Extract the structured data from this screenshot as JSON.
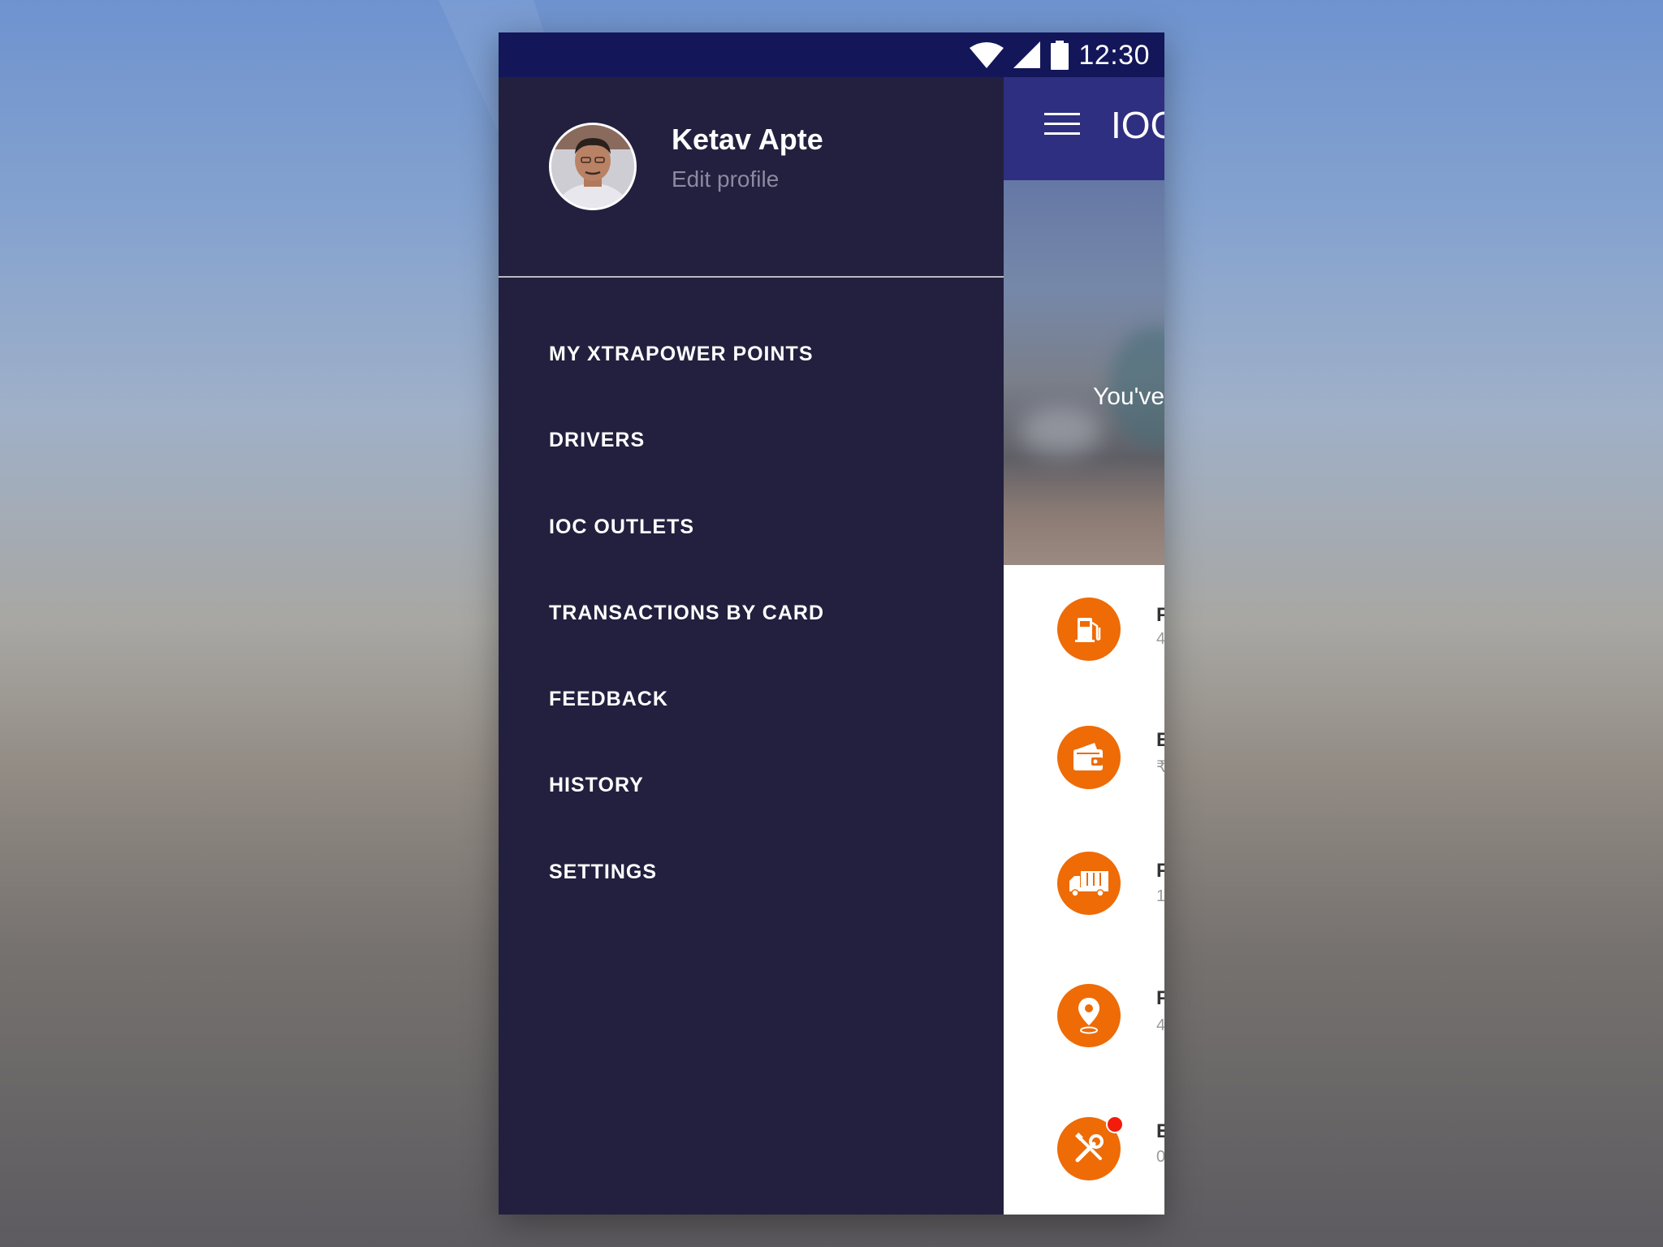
{
  "status_bar": {
    "time": "12:30",
    "icons": [
      "wifi-icon",
      "cell-signal-icon",
      "battery-icon"
    ]
  },
  "app": {
    "title": "IOC",
    "hero_text": "You've",
    "list_items": [
      {
        "icon": "fuel-pump-icon",
        "title": "F",
        "subtitle": "4"
      },
      {
        "icon": "wallet-icon",
        "title": "E",
        "subtitle": "₹"
      },
      {
        "icon": "truck-icon",
        "title": "F",
        "subtitle": "1"
      },
      {
        "icon": "location-pin-icon",
        "title": "F",
        "subtitle": "4"
      },
      {
        "icon": "tools-icon",
        "title": "E",
        "subtitle": "0",
        "badge": true
      }
    ]
  },
  "drawer": {
    "profile": {
      "name": "Ketav Apte",
      "edit_label": "Edit profile"
    },
    "menu": [
      {
        "label": "MY XTRAPOWER POINTS"
      },
      {
        "label": "DRIVERS"
      },
      {
        "label": "IOC OUTLETS"
      },
      {
        "label": "TRANSACTIONS BY CARD"
      },
      {
        "label": "FEEDBACK"
      },
      {
        "label": "HISTORY"
      },
      {
        "label": "SETTINGS"
      }
    ]
  },
  "colors": {
    "status_bar": "#131659",
    "app_bar": "#2e2f80",
    "drawer_bg": "#22203e",
    "accent_orange": "#ee6b06",
    "badge_red": "#f21b0c"
  }
}
